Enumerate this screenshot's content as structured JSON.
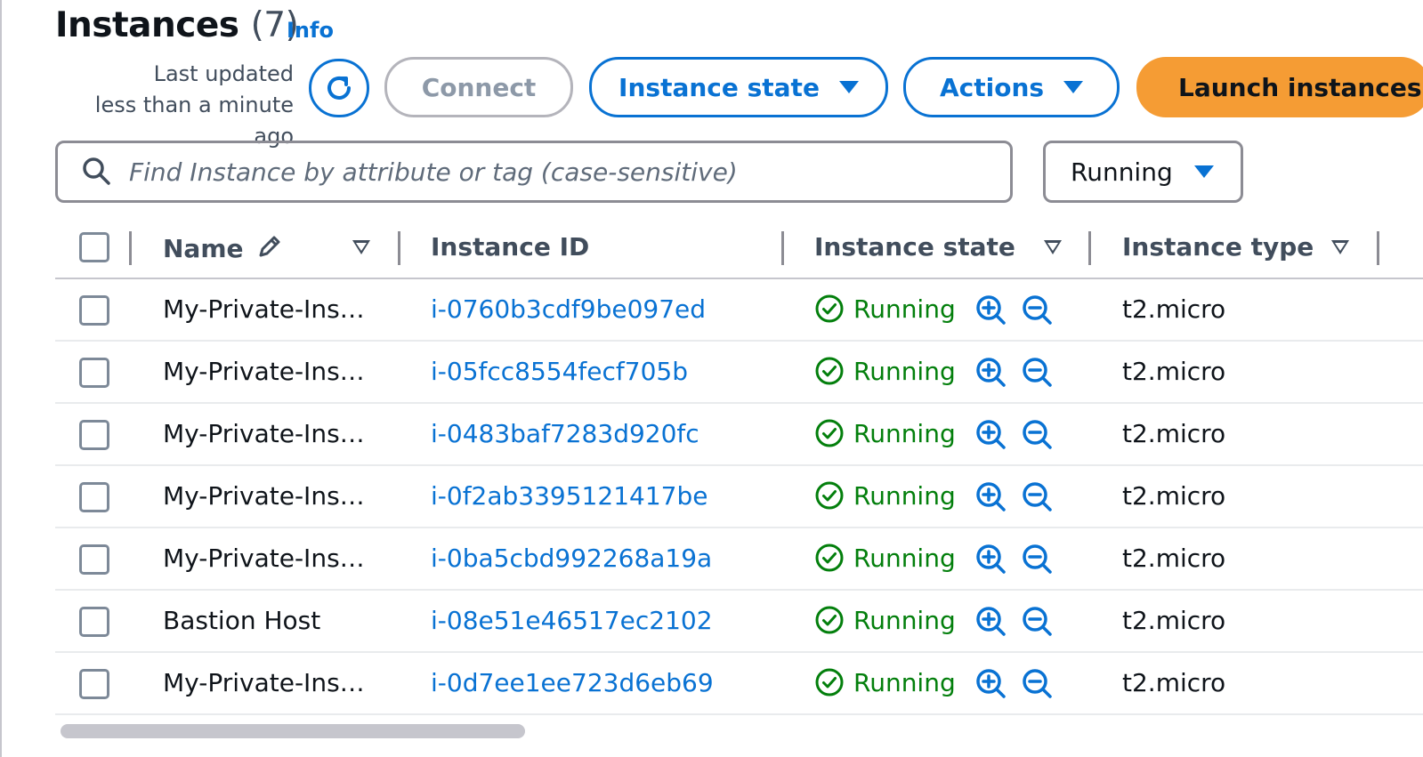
{
  "header": {
    "title": "Instances",
    "count": "(7)",
    "info_label": "Info",
    "last_updated_line1": "Last updated",
    "last_updated_line2": "less than a minute ago"
  },
  "toolbar": {
    "refresh_icon": "refresh-icon",
    "connect_label": "Connect",
    "instance_state_label": "Instance state",
    "actions_label": "Actions",
    "launch_label": "Launch instances"
  },
  "filter": {
    "search_placeholder": "Find Instance by attribute or tag (case-sensitive)",
    "search_value": "",
    "state_filter_value": "Running"
  },
  "table": {
    "columns": {
      "name": "Name",
      "instance_id": "Instance ID",
      "instance_state": "Instance state",
      "instance_type": "Instance type"
    },
    "rows": [
      {
        "name": "My-Private-Ins…",
        "id": "i-0760b3cdf9be097ed",
        "state": "Running",
        "type": "t2.micro"
      },
      {
        "name": "My-Private-Ins…",
        "id": "i-05fcc8554fecf705b",
        "state": "Running",
        "type": "t2.micro"
      },
      {
        "name": "My-Private-Ins…",
        "id": "i-0483baf7283d920fc",
        "state": "Running",
        "type": "t2.micro"
      },
      {
        "name": "My-Private-Ins…",
        "id": "i-0f2ab3395121417be",
        "state": "Running",
        "type": "t2.micro"
      },
      {
        "name": "My-Private-Ins…",
        "id": "i-0ba5cbd992268a19a",
        "state": "Running",
        "type": "t2.micro"
      },
      {
        "name": "Bastion Host",
        "id": "i-08e51e46517ec2102",
        "state": "Running",
        "type": "t2.micro"
      },
      {
        "name": "My-Private-Ins…",
        "id": "i-0d7ee1ee723d6eb69",
        "state": "Running",
        "type": "t2.micro"
      }
    ]
  },
  "colors": {
    "link": "#0972d3",
    "running": "#037f0c",
    "launch_button": "#f59c34",
    "border": "#8c8c94"
  },
  "icons": {
    "search": "search-icon",
    "edit": "pencil-icon",
    "status": "check-circle-icon",
    "zoom_in": "zoom-in-icon",
    "zoom_out": "zoom-out-icon",
    "sort": "sort-caret-icon"
  }
}
